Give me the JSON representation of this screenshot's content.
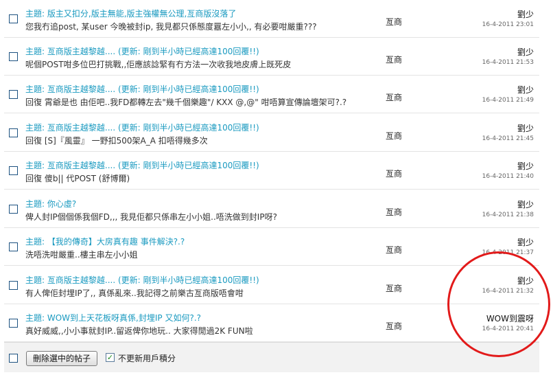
{
  "threads": [
    {
      "prefix": "主題:",
      "title": "版主又扣分,版主無能,版主強權無公理,亙商版沒落了",
      "desc": "您我冇追post, 某user 今晚被封ip, 我見都只係態度囂左小小,, 有必要咁嚴重???",
      "forum": "亙商",
      "author": "劉少",
      "time": "16-4-2011 23:01"
    },
    {
      "prefix": "主題:",
      "title": "亙商版主越黎越.... (更新: 剛到半小時已經高達100回覆!!)",
      "desc": "呢個POST咁多位巴打挑戰,,佢應該諗緊有冇方法一次收我地皮膚上既死皮",
      "forum": "亙商",
      "author": "劉少",
      "time": "16-4-2011 21:53"
    },
    {
      "prefix": "主題:",
      "title": "亙商版主越黎越.... (更新: 剛到半小時已經高達100回覆!!)",
      "desc": "回復 霄爺是也 由佢吧..我FD都轉左去\"幾千個樂趣\"/ KXX @,@\" 咁唔算宣傳論壇架可?.?",
      "forum": "亙商",
      "author": "劉少",
      "time": "16-4-2011 21:49"
    },
    {
      "prefix": "主題:",
      "title": "亙商版主越黎越.... (更新: 剛到半小時已經高達100回覆!!)",
      "desc": "回復 [S]『風靈』 一野扣500架A_A 扣唔得幾多次",
      "forum": "亙商",
      "author": "劉少",
      "time": "16-4-2011 21:45"
    },
    {
      "prefix": "主題:",
      "title": "亙商版主越黎越.... (更新: 剛到半小時已經高達100回覆!!)",
      "desc": "回復 傻b|| 代POST (舒博爾)",
      "forum": "亙商",
      "author": "劉少",
      "time": "16-4-2011 21:40"
    },
    {
      "prefix": "主題:",
      "title": "你心虛?",
      "desc": "俾人封IP個個係我個FD,,, 我見佢都只係串左小小姐..唔洗做到封IP呀?",
      "forum": "亙商",
      "author": "劉少",
      "time": "16-4-2011 21:38"
    },
    {
      "prefix": "主題:",
      "title": "【我的傳奇】大房真有趣 事件解決?.?",
      "desc": "洗唔洗咁嚴重..樓主串左小小姐",
      "forum": "亙商",
      "author": "劉少",
      "time": "16-4-2011 21:37"
    },
    {
      "prefix": "主題:",
      "title": "亙商版主越黎越.... (更新: 剛到半小時已經高達100回覆!!)",
      "desc": "有人俾佢封埋IP了,, 真係亂來..我記得之前樂古亙商版唔會咁",
      "forum": "亙商",
      "author": "劉少",
      "time": "16-4-2011 21:32"
    },
    {
      "prefix": "主題:",
      "title": "WOW到上天花板呀真係,封埋IP 又如何?.?",
      "desc": "真好威威,,小小事就封IP..留返俾你地玩.. 大家得閒過2K FUN啦",
      "forum": "亙商",
      "author": "WOW到震呀",
      "time": "16-4-2011 20:41"
    }
  ],
  "footer": {
    "delete_label": "刪除選中的帖子",
    "no_update_label": "不更新用戶積分",
    "no_update_checked": true
  },
  "annotation_color": "#e21a1a"
}
